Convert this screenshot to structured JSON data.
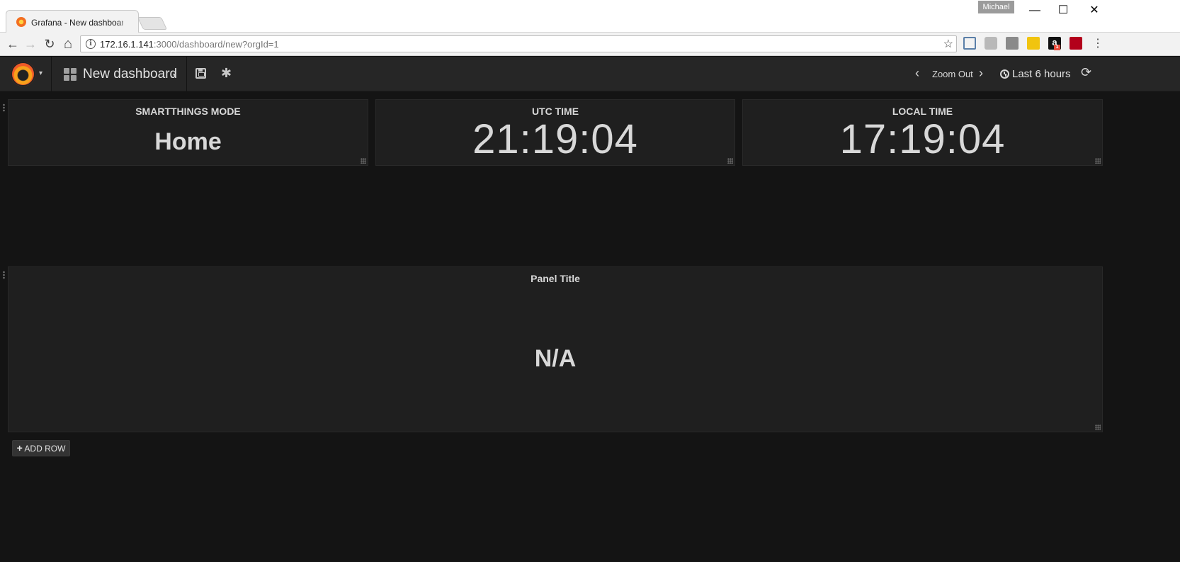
{
  "browser": {
    "tab_title": "Grafana - New dashboard",
    "user_badge": "Michael",
    "url_host": "172.16.1.141",
    "url_rest": ":3000/dashboard/new?orgId=1",
    "window_controls": {
      "minimize": "—",
      "maximize": "☐",
      "close": "✕"
    },
    "nav_glyphs": {
      "back": "←",
      "forward": "→",
      "reload": "↻",
      "home": "⌂",
      "star": "☆",
      "menu": "⋮"
    },
    "extensions": [
      "cast-icon",
      "pushbullet-icon",
      "pocket-icon",
      "lastpass-icon",
      "amazon-icon",
      "acrobat-icon"
    ],
    "extension_badges": {
      "amazon": "1"
    }
  },
  "navbar": {
    "dashboard_title": "New dashboard",
    "zoom_out_label": "Zoom Out",
    "time_range_label": "Last 6 hours",
    "glyphs": {
      "caret": "▾",
      "cog": "✱",
      "prev": "‹",
      "next": "›",
      "refresh": "⟳"
    }
  },
  "panels": [
    {
      "title": "SMARTTHINGS MODE",
      "value": "Home"
    },
    {
      "title": "UTC TIME",
      "value": "21:19:04"
    },
    {
      "title": "LOCAL TIME",
      "value": "17:19:04"
    },
    {
      "title": "Panel Title",
      "value": "N/A"
    }
  ],
  "add_row": {
    "plus": "+",
    "label": "ADD ROW"
  },
  "colors": {
    "background": "#141414",
    "panel": "#1f1f1f",
    "navbar": "#262626",
    "text": "#d8d8d8",
    "grafana_orange": "#f05a28"
  }
}
